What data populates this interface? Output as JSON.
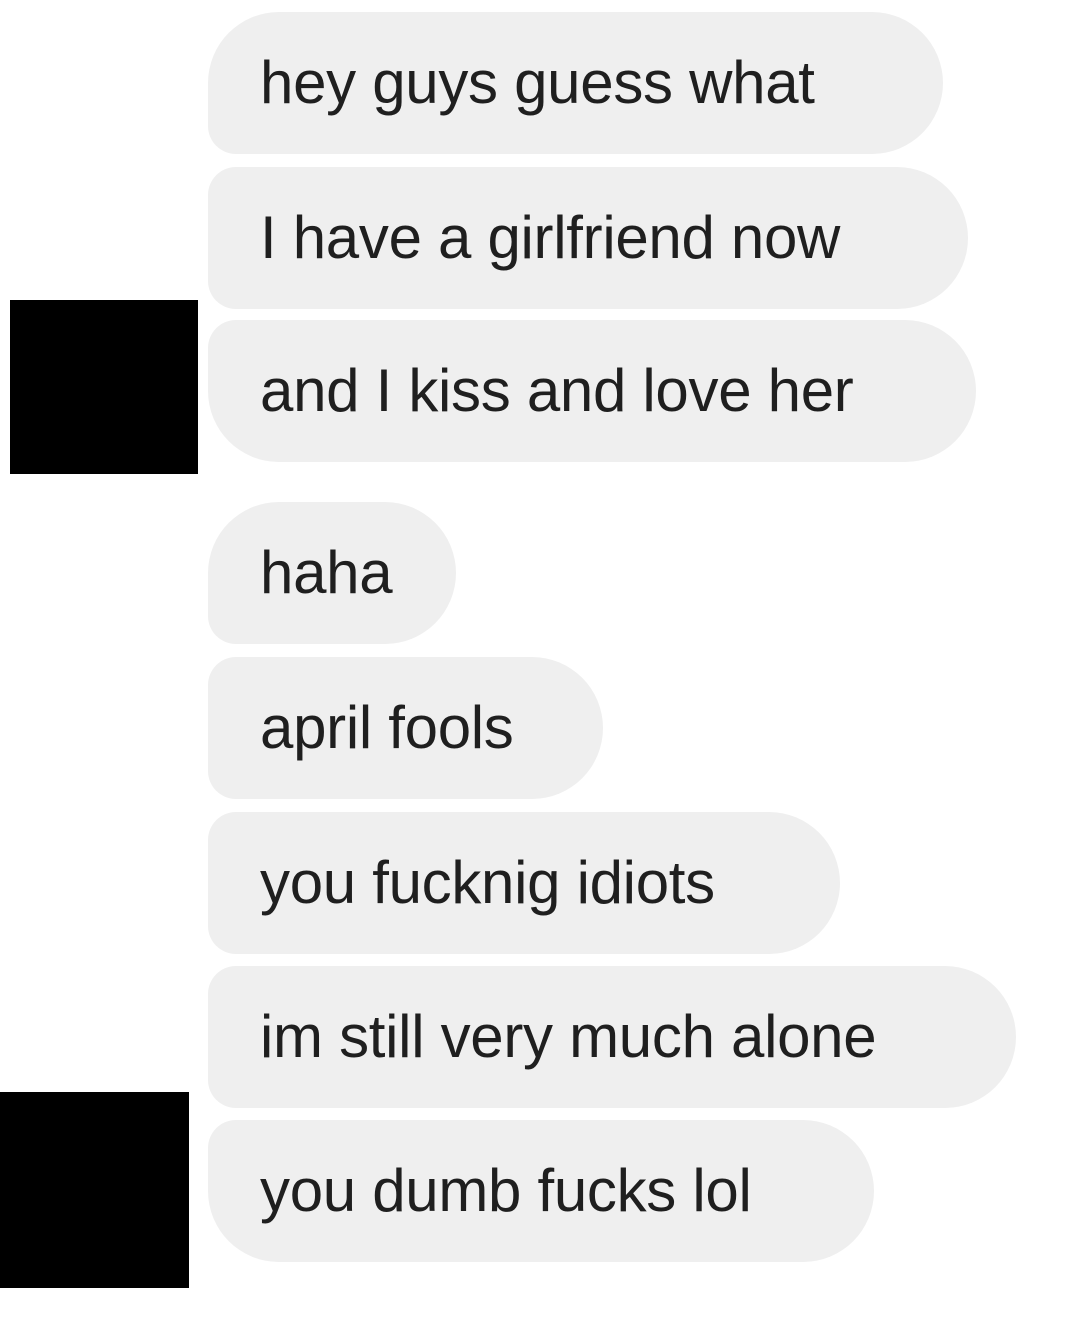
{
  "conversation": {
    "messages": [
      {
        "text": "hey guys guess what"
      },
      {
        "text": "I have a girlfriend now"
      },
      {
        "text": "and I kiss and love her"
      },
      {
        "text": "haha"
      },
      {
        "text": "april fools"
      },
      {
        "text": "you fucknig idiots"
      },
      {
        "text": "im still very much alone"
      },
      {
        "text": "you dumb fucks lol"
      }
    ]
  },
  "colors": {
    "background": "#ffffff",
    "bubble": "#efefef",
    "text": "#1f1f1f",
    "redaction": "#000000"
  }
}
